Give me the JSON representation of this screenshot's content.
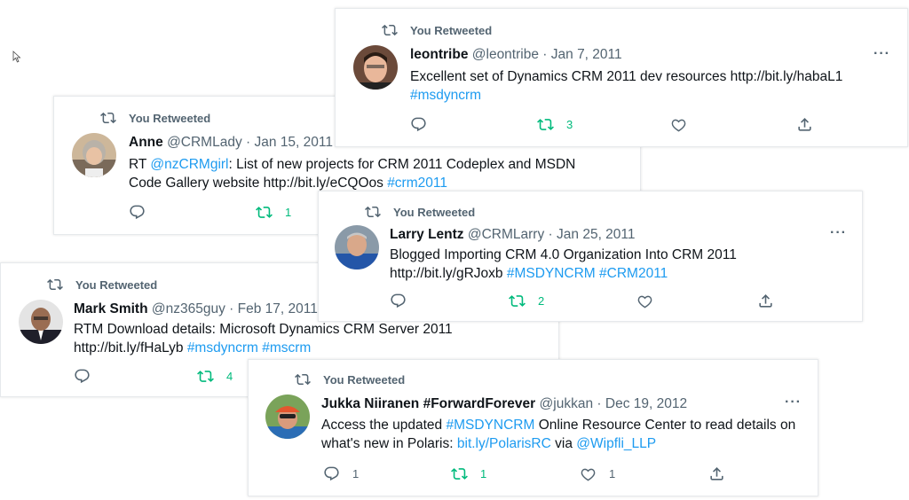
{
  "retweet_label": "You Retweeted",
  "colors": {
    "link": "#1d9bf0",
    "retweet_green": "#00ba7c",
    "meta_gray": "#536471"
  },
  "tweets": [
    {
      "name": "leontribe",
      "handle": "@leontribe",
      "separator": "·",
      "date": "Jan 7, 2011",
      "text": "Excellent set of Dynamics CRM 2011 dev resources http://bit.ly/habaL1",
      "tags": "#msdyncrm",
      "retweets": "3",
      "more": "···"
    },
    {
      "name": "Anne",
      "handle": "@CRMLady",
      "separator": "·",
      "date": "Jan 15, 2011",
      "rt_prefix": "RT",
      "mention": "@nzCRMgirl",
      "text": ": List of new projects for CRM 2011 Codeplex and MSDN Code Gallery website http://bit.ly/eCQOos",
      "tags": "#crm2011",
      "retweets": "1"
    },
    {
      "name": "Larry Lentz",
      "handle": "@CRMLarry",
      "separator": "·",
      "date": "Jan 25, 2011",
      "text": "Blogged Importing CRM 4.0 Organization Into CRM 2011 http://bit.ly/gRJoxb",
      "tags": "#MSDYNCRM #CRM2011",
      "retweets": "2",
      "more": "···"
    },
    {
      "name": "Mark Smith",
      "handle": "@nz365guy",
      "separator": "·",
      "date": "Feb 17, 2011",
      "text": "RTM Download details: Microsoft Dynamics CRM Server 2011 http://bit.ly/fHaLyb",
      "tags": "#msdyncrm #mscrm",
      "retweets": "4"
    },
    {
      "name": "Jukka Niiranen #ForwardForever",
      "handle": "@jukkan",
      "separator": "·",
      "date": "Dec 19, 2012",
      "text_a": "Access the updated",
      "tag_a": "#MSDYNCRM",
      "text_b": "Online Resource Center to read details on what's new in Polaris:",
      "link": "bit.ly/PolarisRC",
      "text_c": "via",
      "mention": "@Wipfli_LLP",
      "replies": "1",
      "retweets": "1",
      "likes": "1",
      "more": "···"
    }
  ]
}
